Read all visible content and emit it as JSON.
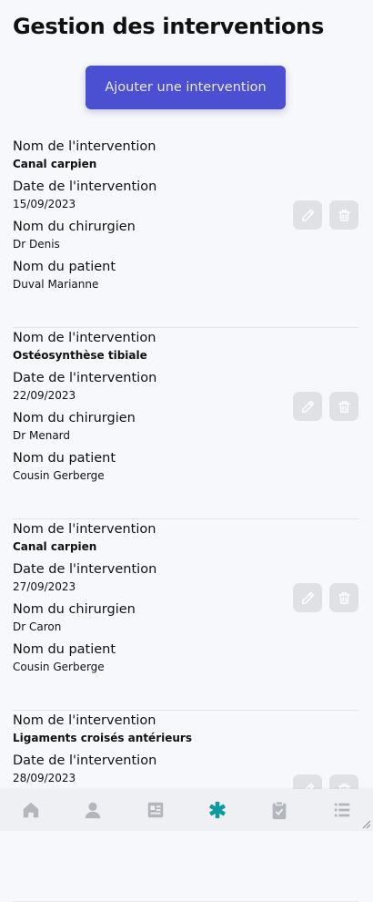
{
  "header": {
    "title": "Gestion des interventions"
  },
  "actions": {
    "add_label": "Ajouter une intervention"
  },
  "labels": {
    "name": "Nom de l'intervention",
    "date": "Date de l'intervention",
    "surgeon": "Nom du chirurgien",
    "patient": "Nom du patient"
  },
  "interventions": [
    {
      "name": "Canal carpien",
      "date": "15/09/2023",
      "surgeon": "Dr Denis",
      "patient": "Duval Marianne"
    },
    {
      "name": "Ostéosynthèse tibiale",
      "date": "22/09/2023",
      "surgeon": "Dr Menard",
      "patient": "Cousin Gerberge"
    },
    {
      "name": "Canal carpien",
      "date": "27/09/2023",
      "surgeon": "Dr Caron",
      "patient": "Cousin Gerberge"
    },
    {
      "name": "Ligaments croisés antérieurs",
      "date": "28/09/2023",
      "surgeon": "",
      "patient": ""
    }
  ],
  "icons": {
    "edit": "pencil-icon",
    "delete": "trash-icon"
  },
  "nav": {
    "items": [
      "home-icon",
      "user-icon",
      "id-card-icon",
      "medical-asterisk-icon",
      "clipboard-icon",
      "list-icon"
    ],
    "active_index": 3
  },
  "colors": {
    "accent": "#4b4fd1",
    "nav_active": "#0f9aa0",
    "nav_inactive": "#b3b6bd",
    "action_bg": "#e0e1e5"
  }
}
